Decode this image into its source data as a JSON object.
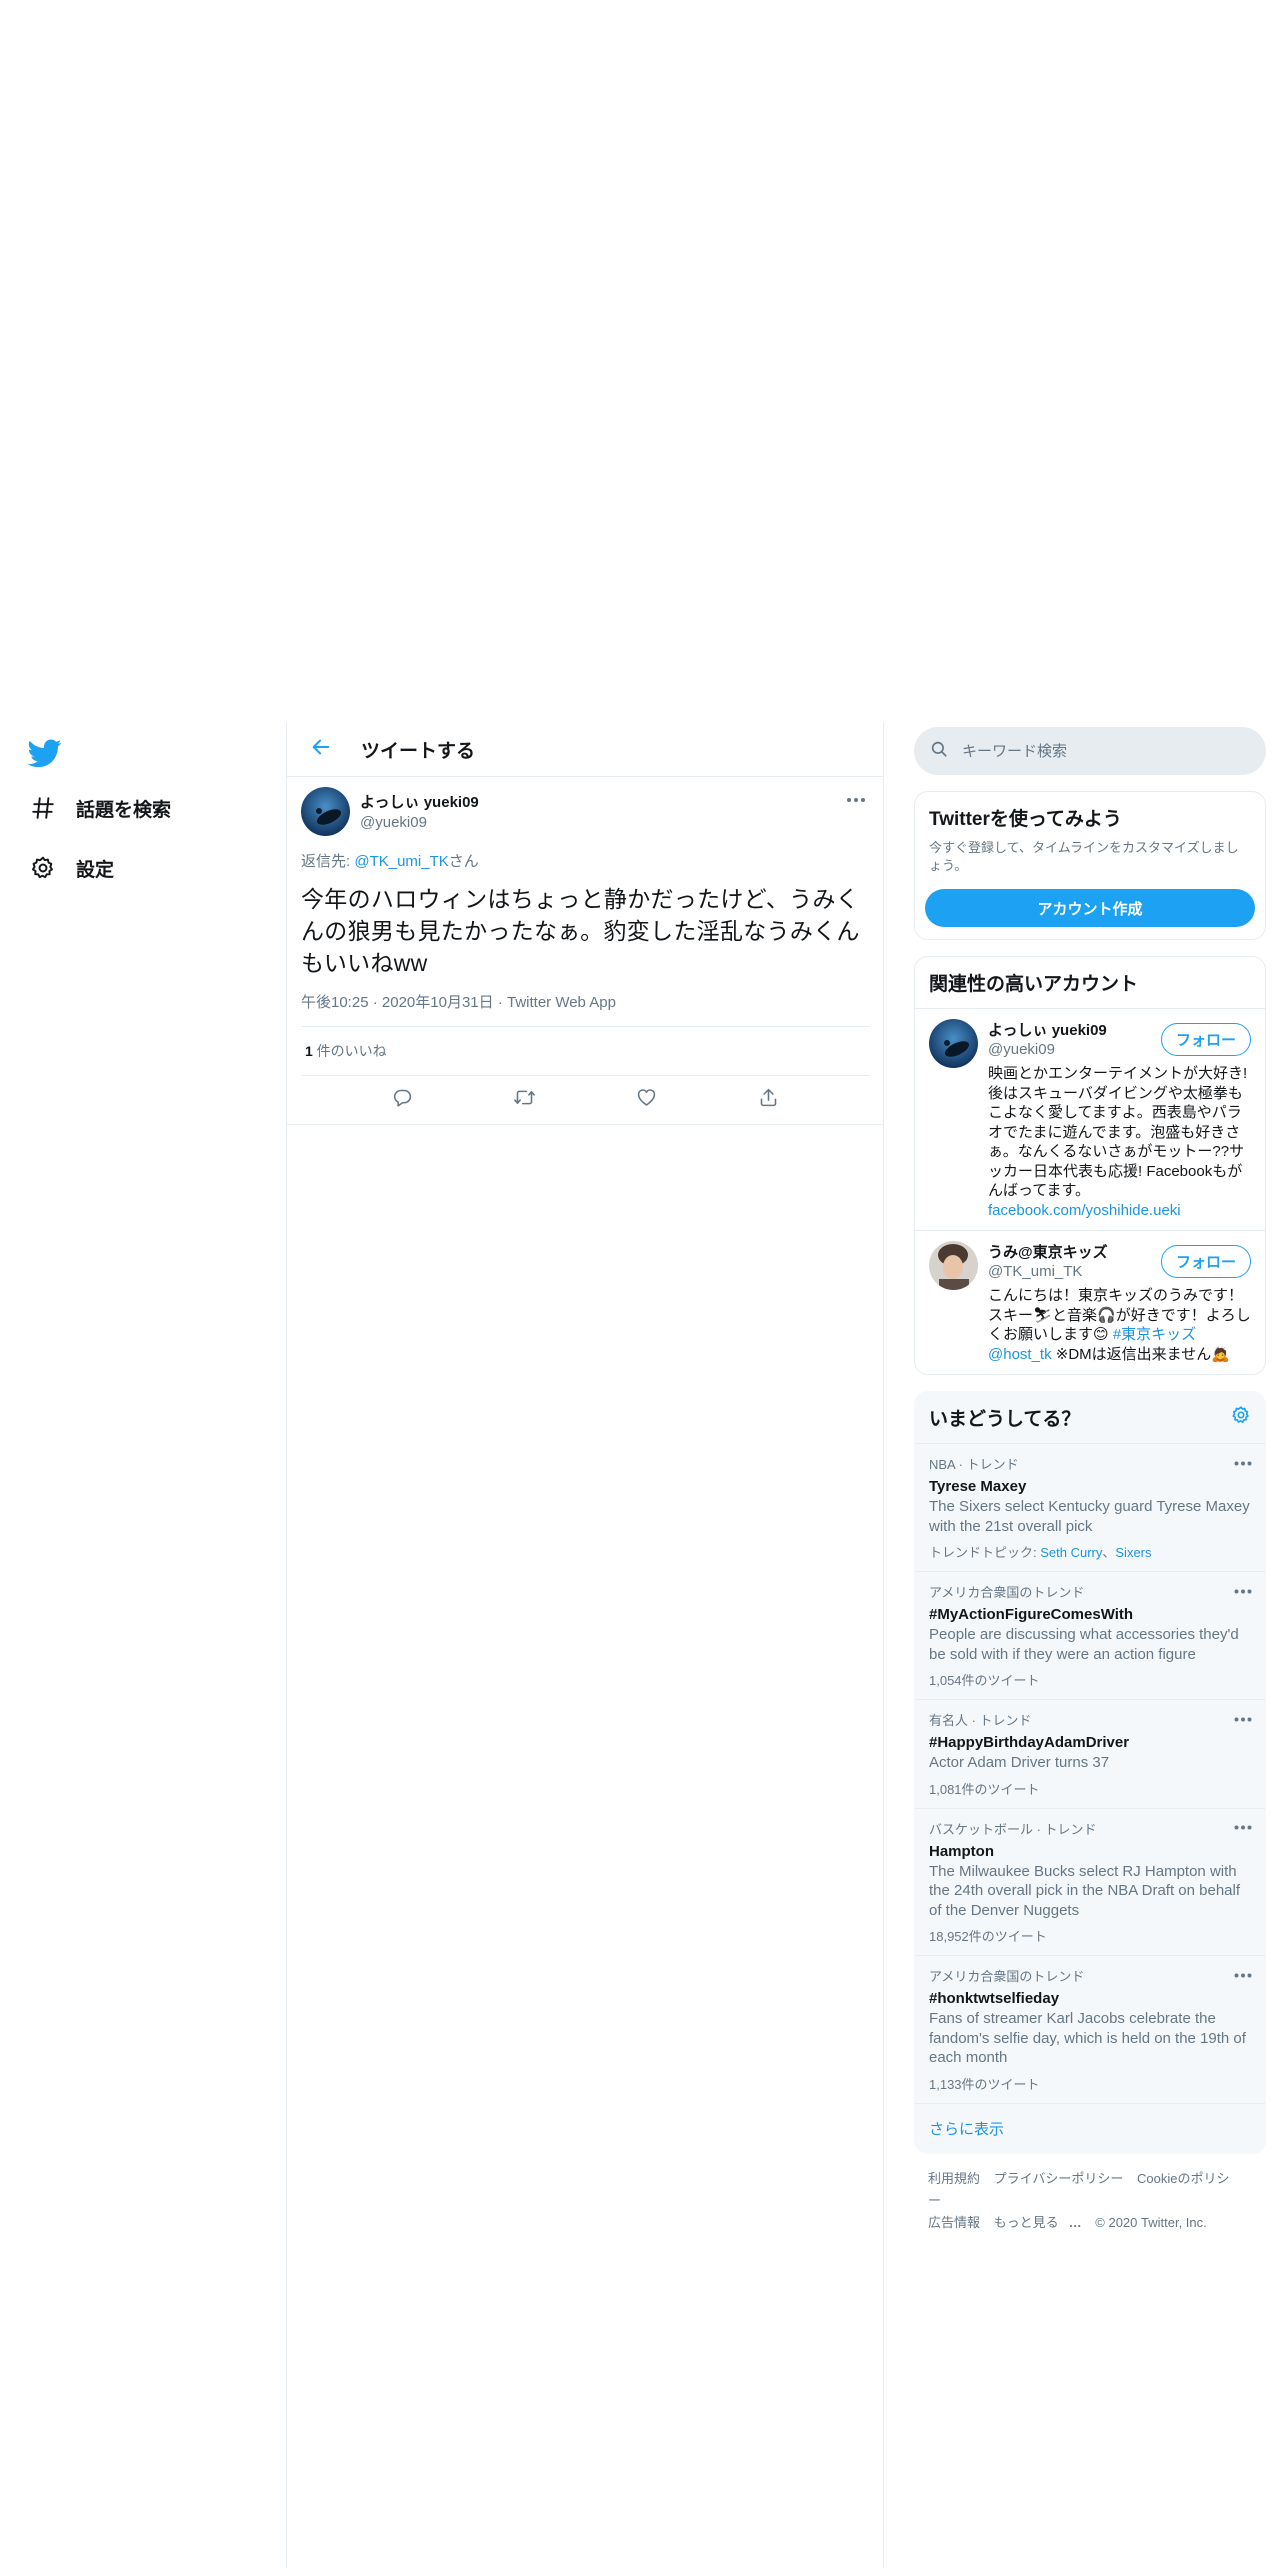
{
  "nav": {
    "items": [
      {
        "label": "話題を検索",
        "icon": "hashtag-icon"
      },
      {
        "label": "設定",
        "icon": "gear-icon"
      }
    ]
  },
  "main": {
    "header_title": "ツイートする",
    "tweet": {
      "name": "よっしぃ yueki09",
      "handle": "@yueki09",
      "reply_prefix": "返信先: ",
      "reply_to": "@TK_umi_TK",
      "reply_suffix": "さん",
      "text": "今年のハロウィンはちょっと静かだったけど、うみくんの狼男も見たかったなぁ。豹変した淫乱なうみくんもいいねww",
      "time": "午後10:25",
      "date": "2020年10月31日",
      "source": "Twitter Web App",
      "like_count": "1",
      "like_label": " 件のいいね"
    }
  },
  "right": {
    "search_placeholder": "キーワード検索",
    "signup": {
      "title": "Twitterを使ってみよう",
      "desc": "今すぐ登録して、タイムラインをカスタマイズしましょう。",
      "button": "アカウント作成"
    },
    "related": {
      "title": "関連性の高いアカウント",
      "follow_label": "フォロー",
      "accounts": [
        {
          "name": "よっしぃ yueki09",
          "handle": "@yueki09",
          "bio": "映画とかエンターテイメントが大好き!後はスキューバダイビングや太極拳もこよなく愛してますよ。西表島やパラオでたまに遊んでます。泡盛も好きさぁ。なんくるないさぁがモットー??サッカー日本代表も応援! Facebookもがんばってます。",
          "link": "facebook.com/yoshihide.ueki"
        },
        {
          "name": "うみ@東京キッズ",
          "handle": "@TK_umi_TK",
          "bio_1": "こんにちは！東京キッズのうみです！スキー⛷と音楽🎧が好きです！よろしくお願いします😊 ",
          "bio_tag": "#東京キッズ",
          "bio_mention": "@host_tk",
          "bio_2": " ※DMは返信出来ません🙇"
        }
      ]
    },
    "trends": {
      "title": "いまどうしてる？",
      "items": [
        {
          "context": "NBA · トレンド",
          "name": "Tyrese Maxey",
          "desc": "The Sixers select Kentucky guard Tyrese Maxey with the 21st overall pick",
          "topic_label": "トレンドトピック: ",
          "topic_1": "Seth Curry",
          "topic_sep": "、",
          "topic_2": "Sixers"
        },
        {
          "context": "アメリカ合衆国のトレンド",
          "name": "#MyActionFigureComesWith",
          "desc": "People are discussing what accessories they'd be sold with if they were an action figure",
          "count": "1,054件のツイート"
        },
        {
          "context": "有名人 · トレンド",
          "name": "#HappyBirthdayAdamDriver",
          "desc": "Actor Adam Driver turns 37",
          "count": "1,081件のツイート"
        },
        {
          "context": "バスケットボール · トレンド",
          "name": "Hampton",
          "desc": "The Milwaukee Bucks select RJ Hampton with the 24th overall pick in the NBA Draft on behalf of the Denver Nuggets",
          "count": "18,952件のツイート"
        },
        {
          "context": "アメリカ合衆国のトレンド",
          "name": "#honktwtselfieday",
          "desc": "Fans of streamer Karl Jacobs celebrate the fandom's selfie day, which is held on the 19th of each month",
          "count": "1,133件のツイート"
        }
      ],
      "show_more": "さらに表示"
    },
    "footer": {
      "links": [
        "利用規約",
        "プライバシーポリシー",
        "Cookieのポリシー",
        "広告情報",
        "もっと見る"
      ],
      "more_dots": "…",
      "copyright": "© 2020 Twitter, Inc."
    }
  },
  "colors": {
    "accent": "#1da1f2",
    "link": "#1b95e0",
    "text": "#14171a",
    "secondary": "#657786",
    "border": "#e6ecf0"
  }
}
